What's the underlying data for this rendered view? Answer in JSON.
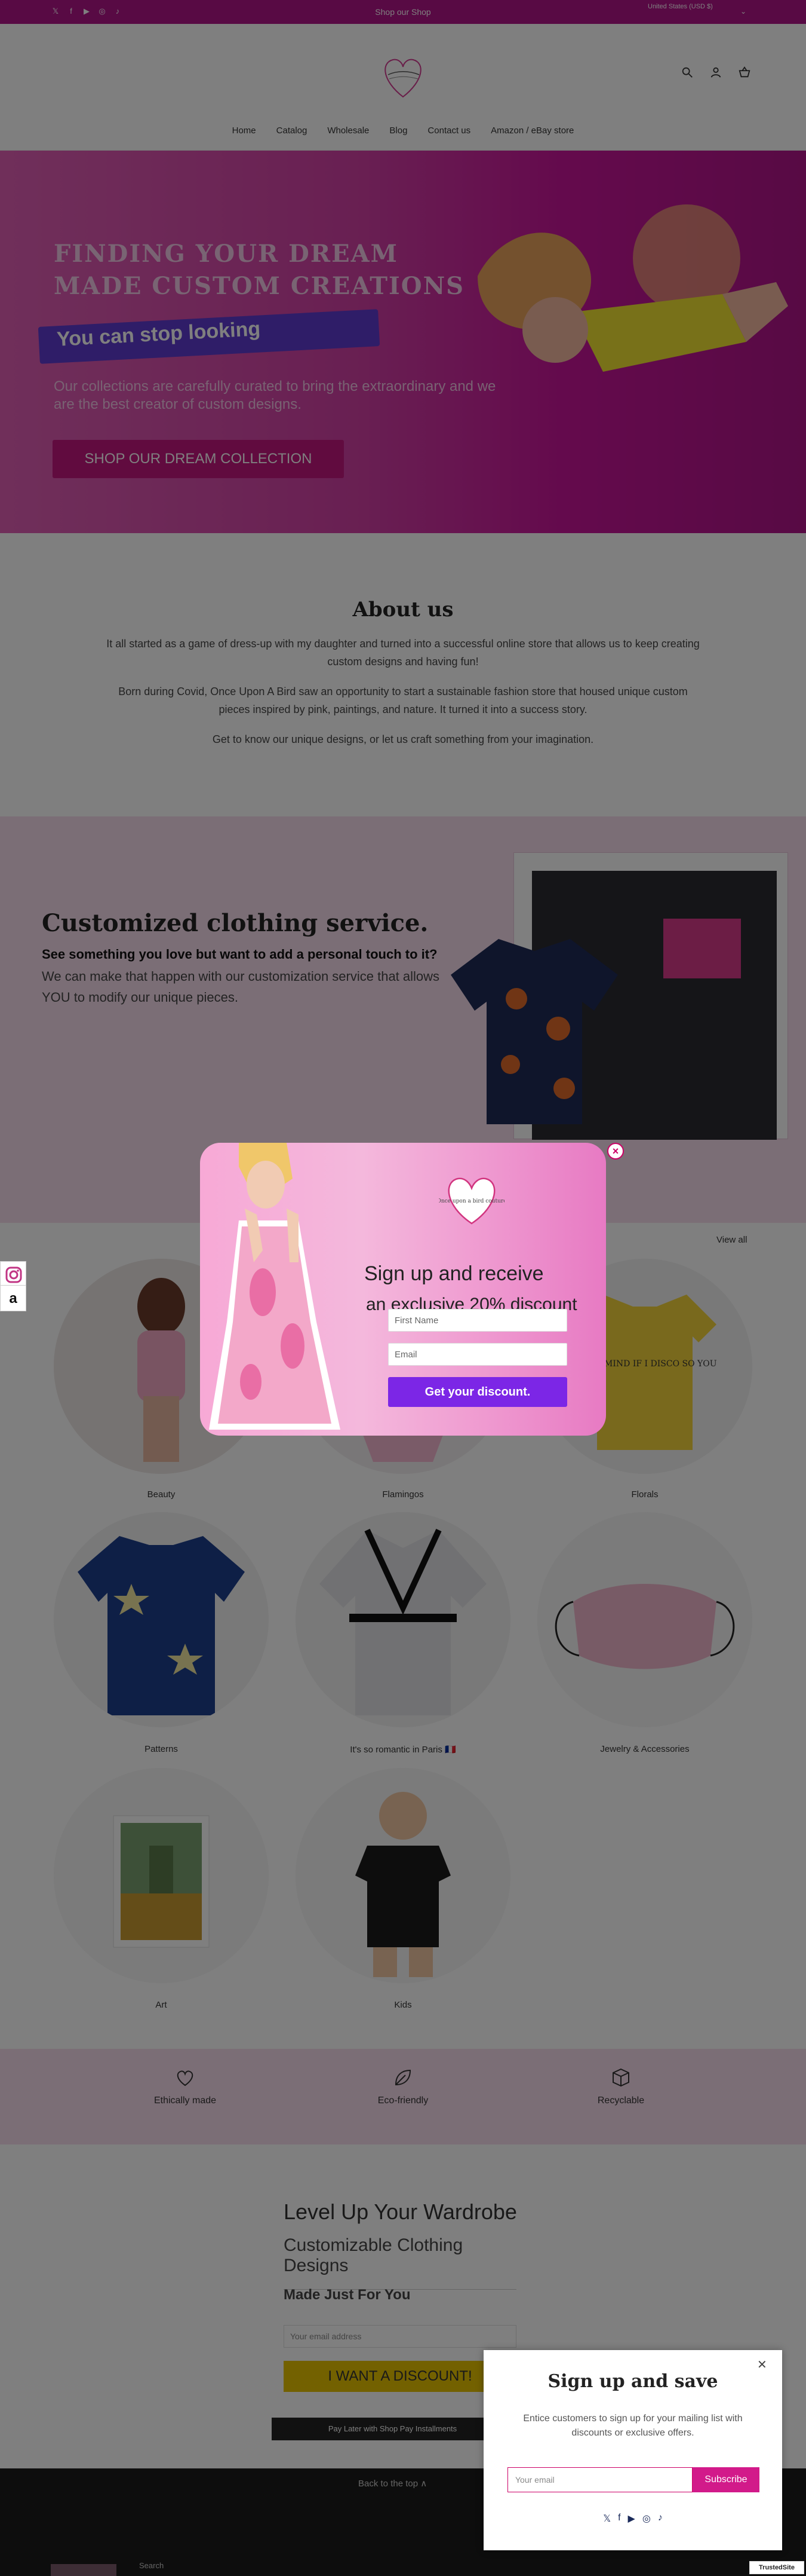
{
  "announcement": {
    "text": "Shop our Shop"
  },
  "currency": {
    "label": "United States (USD $)"
  },
  "nav": {
    "items": [
      "Home",
      "Catalog",
      "Wholesale",
      "Blog",
      "Contact us",
      "Amazon / eBay store"
    ]
  },
  "hero": {
    "headline": "FINDING YOUR DREAM MADE CUSTOM CREATIONS",
    "highlight": "You can stop looking",
    "subtext": "Our collections are carefully curated to bring the extraordinary and we are the best creator of custom designs.",
    "cta": "SHOP OUR DREAM COLLECTION"
  },
  "about": {
    "title": "About us",
    "p1": "It all started as a game of dress-up with my daughter and turned into a successful online store that allows us to keep creating custom designs and having fun!",
    "p2": "Born during Covid, Once Upon A Bird saw an opportunity to start a sustainable fashion store that housed unique custom pieces inspired by pink, paintings, and nature. It turned it into a success story.",
    "p3": "Get to know our unique designs, or let us craft something from your imagination."
  },
  "custom": {
    "title": "Customized clothing service.",
    "bold": "See something you love but want to add a personal touch to it?",
    "body": "We can make that happen with our customization service that allows YOU to modify our unique pieces."
  },
  "collections": {
    "view_all": "View all",
    "items": [
      {
        "label": "Beauty"
      },
      {
        "label": "Flamingos"
      },
      {
        "label": "Florals"
      },
      {
        "label": "Patterns"
      },
      {
        "label": "It's so romantic in Paris 🇫🇷"
      },
      {
        "label": "Jewelry & Accessories"
      },
      {
        "label": "Art"
      },
      {
        "label": "Kids"
      }
    ],
    "tshirt_text": "DON'T MIND IF I DISCO SO YOU"
  },
  "features": [
    {
      "label": "Ethically made",
      "icon": "heart-icon"
    },
    {
      "label": "Eco-friendly",
      "icon": "leaf-icon"
    },
    {
      "label": "Recyclable",
      "icon": "box-icon"
    }
  ],
  "newsletter": {
    "h1": "Level Up Your Wardrobe",
    "h2": "Customizable Clothing Designs",
    "h3": "Made Just For You",
    "email_placeholder": "Your email address",
    "button": "I WANT A DISCOUNT!",
    "shop_pay": "Pay Later with Shop Pay Installments"
  },
  "footer": {
    "back_to_top": "Back to the top ∧",
    "search": "Search"
  },
  "popup": {
    "logo_text": "Once upon a bird couture",
    "head1": "Sign up and receive",
    "head2": "an exclusive 20% discount",
    "first_name_placeholder": "First Name",
    "email_placeholder": "Email",
    "button": "Get your discount."
  },
  "side": {
    "amazon": "a"
  },
  "br_popup": {
    "title": "Sign up and save",
    "desc": "Entice customers to sign up for your mailing list with discounts or exclusive offers.",
    "email_placeholder": "Your email",
    "button": "Subscribe"
  },
  "trusted": {
    "label": "TrustedSite"
  },
  "colors": {
    "brand": "#b01489",
    "pink_bg": "#f6dcec",
    "popup_button": "#7c26e6",
    "yellow_button": "#e6c200"
  }
}
